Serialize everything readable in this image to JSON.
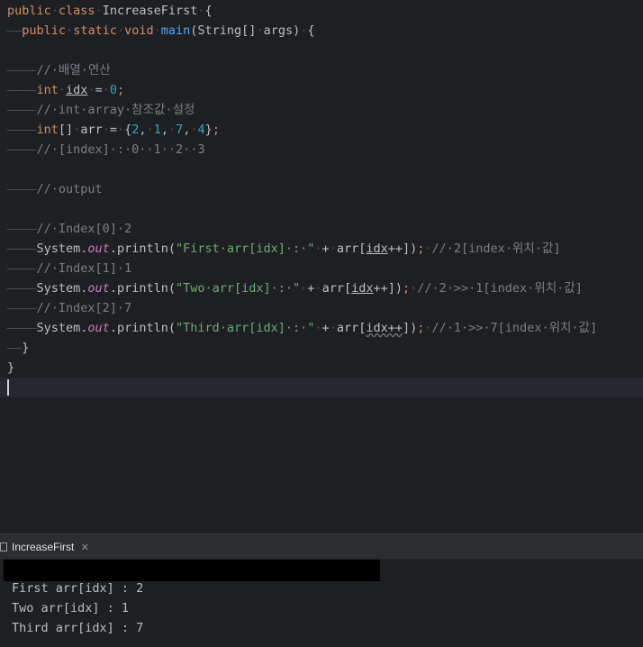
{
  "code_lines": [
    [
      {
        "c": "kw",
        "t": "public"
      },
      {
        "c": "dot",
        "t": "·"
      },
      {
        "c": "kw",
        "t": "class"
      },
      {
        "c": "dot",
        "t": "·"
      },
      {
        "c": "",
        "t": "IncreaseFirst"
      },
      {
        "c": "dot",
        "t": "·"
      },
      {
        "c": "",
        "t": "{"
      }
    ],
    [
      {
        "c": "dash",
        "t": "——"
      },
      {
        "c": "kw",
        "t": "public"
      },
      {
        "c": "dot",
        "t": "·"
      },
      {
        "c": "kw",
        "t": "static"
      },
      {
        "c": "dot",
        "t": "·"
      },
      {
        "c": "kw",
        "t": "void"
      },
      {
        "c": "dot",
        "t": "·"
      },
      {
        "c": "fn",
        "t": "main"
      },
      {
        "c": "",
        "t": "(String[]"
      },
      {
        "c": "dot",
        "t": "·"
      },
      {
        "c": "",
        "t": "args)"
      },
      {
        "c": "dot",
        "t": "·"
      },
      {
        "c": "",
        "t": "{"
      }
    ],
    [],
    [
      {
        "c": "dash",
        "t": "————"
      },
      {
        "c": "cm",
        "t": "//·배열·연산"
      }
    ],
    [
      {
        "c": "dash",
        "t": "————"
      },
      {
        "c": "kw",
        "t": "int"
      },
      {
        "c": "dot",
        "t": "·"
      },
      {
        "c": "ul",
        "t": "idx"
      },
      {
        "c": "dot",
        "t": "·"
      },
      {
        "c": "",
        "t": "="
      },
      {
        "c": "dot",
        "t": "·"
      },
      {
        "c": "num",
        "t": "0"
      },
      {
        "c": "kw",
        "t": ";"
      }
    ],
    [
      {
        "c": "dash",
        "t": "————"
      },
      {
        "c": "cm",
        "t": "//·int·array·참조값·설정"
      }
    ],
    [
      {
        "c": "dash",
        "t": "————"
      },
      {
        "c": "kw",
        "t": "int"
      },
      {
        "c": "",
        "t": "[]"
      },
      {
        "c": "dot",
        "t": "·"
      },
      {
        "c": "",
        "t": "arr"
      },
      {
        "c": "dot",
        "t": "·"
      },
      {
        "c": "",
        "t": "="
      },
      {
        "c": "dot",
        "t": "·"
      },
      {
        "c": "",
        "t": "{"
      },
      {
        "c": "num",
        "t": "2"
      },
      {
        "c": "",
        "t": ","
      },
      {
        "c": "dot",
        "t": "·"
      },
      {
        "c": "num",
        "t": "1"
      },
      {
        "c": "",
        "t": ","
      },
      {
        "c": "dot",
        "t": "·"
      },
      {
        "c": "num",
        "t": "7"
      },
      {
        "c": "",
        "t": ","
      },
      {
        "c": "dot",
        "t": "·"
      },
      {
        "c": "num",
        "t": "4"
      },
      {
        "c": "",
        "t": "}"
      },
      {
        "c": "kw",
        "t": ";"
      }
    ],
    [
      {
        "c": "dash",
        "t": "————"
      },
      {
        "c": "cm",
        "t": "//·[index]·:·0··1··2··3"
      }
    ],
    [],
    [
      {
        "c": "dash",
        "t": "————"
      },
      {
        "c": "cm",
        "t": "//·output"
      }
    ],
    [],
    [
      {
        "c": "dash",
        "t": "————"
      },
      {
        "c": "cm",
        "t": "//·Index[0]·2"
      }
    ],
    [
      {
        "c": "dash",
        "t": "————"
      },
      {
        "c": "",
        "t": "System."
      },
      {
        "c": "field",
        "t": "out"
      },
      {
        "c": "",
        "t": ".println("
      },
      {
        "c": "str",
        "t": "\"First·arr[idx]·:·\""
      },
      {
        "c": "dot",
        "t": "·"
      },
      {
        "c": "",
        "t": "+"
      },
      {
        "c": "dot",
        "t": "·"
      },
      {
        "c": "",
        "t": "arr["
      },
      {
        "c": "ul",
        "t": "idx"
      },
      {
        "c": "",
        "t": "++])"
      },
      {
        "c": "kw",
        "t": ";"
      },
      {
        "c": "dot",
        "t": "·"
      },
      {
        "c": "cm",
        "t": "//·2[index·위치·값]"
      }
    ],
    [
      {
        "c": "dash",
        "t": "————"
      },
      {
        "c": "cm",
        "t": "//·Index[1]·1"
      }
    ],
    [
      {
        "c": "dash",
        "t": "————"
      },
      {
        "c": "",
        "t": "System."
      },
      {
        "c": "field",
        "t": "out"
      },
      {
        "c": "",
        "t": ".println("
      },
      {
        "c": "str",
        "t": "\"Two·arr[idx]·:·\""
      },
      {
        "c": "dot",
        "t": "·"
      },
      {
        "c": "",
        "t": "+"
      },
      {
        "c": "dot",
        "t": "·"
      },
      {
        "c": "",
        "t": "arr["
      },
      {
        "c": "ul",
        "t": "idx"
      },
      {
        "c": "",
        "t": "++])"
      },
      {
        "c": "kw",
        "t": ";"
      },
      {
        "c": "dot",
        "t": "·"
      },
      {
        "c": "cm",
        "t": "//·2·>>·1[index·위치·값]"
      }
    ],
    [
      {
        "c": "dash",
        "t": "————"
      },
      {
        "c": "cm",
        "t": "//·Index[2]·7"
      }
    ],
    [
      {
        "c": "dash",
        "t": "————"
      },
      {
        "c": "",
        "t": "System."
      },
      {
        "c": "field",
        "t": "out"
      },
      {
        "c": "",
        "t": ".println("
      },
      {
        "c": "str",
        "t": "\"Third·arr[idx]·:·\""
      },
      {
        "c": "dot",
        "t": "·"
      },
      {
        "c": "",
        "t": "+"
      },
      {
        "c": "dot",
        "t": "·"
      },
      {
        "c": "",
        "t": "arr["
      },
      {
        "c": "wavy",
        "t": "idx++"
      },
      {
        "c": "",
        "t": "])"
      },
      {
        "c": "kw",
        "t": ";"
      },
      {
        "c": "dot",
        "t": "·"
      },
      {
        "c": "cm",
        "t": "//·1·>>·7[index·위치·값]"
      }
    ],
    [
      {
        "c": "dash",
        "t": "——"
      },
      {
        "c": "",
        "t": "}"
      }
    ],
    [
      {
        "c": "",
        "t": "}"
      }
    ]
  ],
  "run_panel": {
    "tab_label": "IncreaseFirst",
    "close_glyph": "✕",
    "tab_icon": "run-config-icon"
  },
  "console_output": [
    "First arr[idx] : 2",
    "Two arr[idx] : 1",
    "Third arr[idx] : 7"
  ]
}
